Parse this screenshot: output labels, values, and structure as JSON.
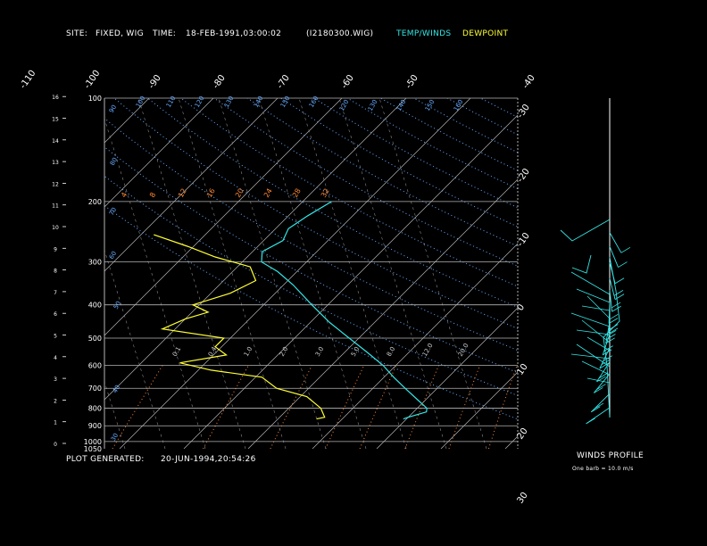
{
  "header": {
    "site_label": "SITE:",
    "site_value": "FIXED, WIG",
    "time_label": "TIME:",
    "time_value": "18-FEB-1991,03:00:02",
    "file_id": "(I2180300.WIG)",
    "legend_temp": "TEMP/WINDS",
    "legend_dew": "DEWPOINT"
  },
  "footer": {
    "generated_label": "PLOT GENERATED:",
    "generated_value": "20-JUN-1994,20:54:26",
    "winds_title": "WINDS PROFILE",
    "winds_note": "One barb = 10.0 m/s"
  },
  "colors": {
    "background": "#000000",
    "temp": "#33e6e6",
    "dewpoint": "#ffff33",
    "mixing_ratio": "#ff8833",
    "dry_adiabat": "#66aaff",
    "grid": "#b4b4b4",
    "wind": "#33e6e6"
  },
  "chart_data": {
    "type": "line",
    "title": "",
    "xlabel": "",
    "ylabel": "",
    "pressure_labels_hPa": [
      100,
      200,
      300,
      400,
      500,
      600,
      700,
      800,
      900,
      1000,
      1050
    ],
    "height_km_ticks": [
      0,
      1,
      2,
      3,
      4,
      5,
      6,
      7,
      8,
      9,
      10,
      11,
      12,
      13,
      14,
      15,
      16
    ],
    "ylim_hPa": [
      1050,
      100
    ],
    "temp_labels_top": [
      -110,
      -100,
      -90,
      -80,
      -70,
      -60,
      -50,
      -40
    ],
    "temp_labels_right": [
      -30,
      -20,
      -10,
      0,
      10,
      20,
      30
    ],
    "dry_adiabat_labels": [
      30,
      40,
      50,
      60,
      70,
      80,
      90,
      100,
      110,
      120,
      130,
      140,
      150,
      160
    ],
    "mixing_ratio_labels_upper": [
      4,
      8,
      12,
      16,
      20,
      24,
      28,
      32
    ],
    "mixing_ratio_labels_lower": [
      "0.1",
      "0.4",
      "1.0",
      "2.0",
      "3.0",
      "5.0",
      "8.0",
      "12.0",
      "20.0"
    ],
    "grid": true,
    "series": [
      {
        "name": "TEMP/WINDS",
        "points": [
          {
            "p": 860,
            "t": -0.5
          },
          {
            "p": 850,
            "t": 0.0
          },
          {
            "p": 820,
            "t": 2.0
          },
          {
            "p": 800,
            "t": 1.5
          },
          {
            "p": 760,
            "t": -1.0
          },
          {
            "p": 700,
            "t": -5.0
          },
          {
            "p": 650,
            "t": -8.5
          },
          {
            "p": 600,
            "t": -12.0
          },
          {
            "p": 550,
            "t": -16.5
          },
          {
            "p": 500,
            "t": -21.5
          },
          {
            "p": 450,
            "t": -27.0
          },
          {
            "p": 400,
            "t": -32.5
          },
          {
            "p": 350,
            "t": -38.5
          },
          {
            "p": 320,
            "t": -43.0
          },
          {
            "p": 300,
            "t": -47.0
          },
          {
            "p": 280,
            "t": -48.5
          },
          {
            "p": 260,
            "t": -47.0
          },
          {
            "p": 240,
            "t": -48.0
          },
          {
            "p": 220,
            "t": -47.0
          },
          {
            "p": 200,
            "t": -45.5
          }
        ]
      },
      {
        "name": "DEWPOINT",
        "points": [
          {
            "p": 860,
            "t": -14.0
          },
          {
            "p": 850,
            "t": -13.0
          },
          {
            "p": 800,
            "t": -15.0
          },
          {
            "p": 740,
            "t": -19.0
          },
          {
            "p": 700,
            "t": -25.0
          },
          {
            "p": 650,
            "t": -29.0
          },
          {
            "p": 620,
            "t": -38.0
          },
          {
            "p": 590,
            "t": -44.0
          },
          {
            "p": 560,
            "t": -38.0
          },
          {
            "p": 530,
            "t": -41.0
          },
          {
            "p": 500,
            "t": -41.0
          },
          {
            "p": 470,
            "t": -52.0
          },
          {
            "p": 440,
            "t": -50.0
          },
          {
            "p": 420,
            "t": -47.5
          },
          {
            "p": 400,
            "t": -51.0
          },
          {
            "p": 370,
            "t": -47.0
          },
          {
            "p": 340,
            "t": -45.0
          },
          {
            "p": 310,
            "t": -48.0
          },
          {
            "p": 290,
            "t": -55.0
          },
          {
            "p": 270,
            "t": -61.0
          },
          {
            "p": 250,
            "t": -68.0
          }
        ]
      }
    ],
    "winds_profile": {
      "barb_speed_mps": 10.0,
      "wind_points": [
        {
          "y": 0.05,
          "dir": 250,
          "spd": 12
        },
        {
          "y": 0.12,
          "dir": 260,
          "spd": 18
        },
        {
          "y": 0.22,
          "dir": 265,
          "spd": 22
        },
        {
          "y": 0.28,
          "dir": 270,
          "spd": 20
        },
        {
          "y": 0.35,
          "dir": 275,
          "spd": 25
        },
        {
          "y": 0.42,
          "dir": 280,
          "spd": 24
        },
        {
          "y": 0.48,
          "dir": 285,
          "spd": 26
        },
        {
          "y": 0.53,
          "dir": 290,
          "spd": 22
        },
        {
          "y": 0.58,
          "dir": 290,
          "spd": 20
        },
        {
          "y": 0.64,
          "dir": 295,
          "spd": 18
        },
        {
          "y": 0.7,
          "dir": 300,
          "spd": 16
        },
        {
          "y": 0.78,
          "dir": 300,
          "spd": 12
        },
        {
          "y": 0.86,
          "dir": 305,
          "spd": 10
        },
        {
          "y": 0.93,
          "dir": 310,
          "spd": 8
        }
      ]
    }
  }
}
